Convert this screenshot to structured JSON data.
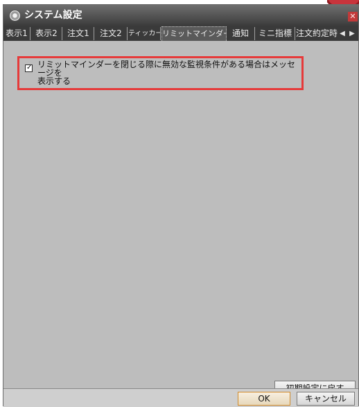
{
  "window": {
    "title": "システム設定",
    "close_glyph": "✕"
  },
  "icons": {
    "app": "gear-icon",
    "close": "close-icon",
    "nav_left": "triangle-left-icon",
    "nav_right": "triangle-right-icon",
    "check": "checkmark-icon"
  },
  "tabs": [
    {
      "label": "表示1"
    },
    {
      "label": "表示2"
    },
    {
      "label": "注文1"
    },
    {
      "label": "注文2"
    },
    {
      "label": "ティッカー"
    },
    {
      "label": "リミットマインダー",
      "active": true
    },
    {
      "label": "通知"
    },
    {
      "label": "ミニ指標"
    },
    {
      "label": "注文約定時"
    }
  ],
  "tab_nav": {
    "left": "◀",
    "right": "▶"
  },
  "option": {
    "checked": true,
    "check_glyph": "✓",
    "label_line1": "リミットマインダーを閉じる際に無効な監視条件がある場合はメッセージを",
    "label_line2": "表示する"
  },
  "buttons": {
    "reset": "初期設定に戻す",
    "ok": "OK",
    "cancel": "キャンセル"
  },
  "colors": {
    "highlight_border": "#e63a3a",
    "ok_border": "#d08a2a",
    "titlebar": "#4a4a4a",
    "panel": "#bdbdbd"
  }
}
